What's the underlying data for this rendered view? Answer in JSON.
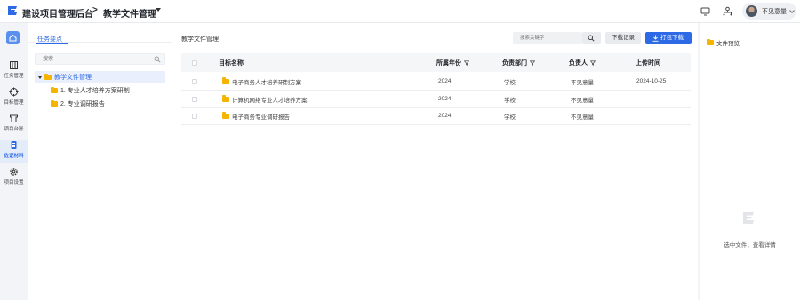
{
  "header": {
    "app_title": "建设项目管理后台",
    "separator": ">",
    "page_title": "教学文件管理",
    "user_name": "不见意量"
  },
  "nav": {
    "items": [
      {
        "label": "任务管理",
        "icon": "tasks-icon"
      },
      {
        "label": "目标管理",
        "icon": "target-icon"
      },
      {
        "label": "项目台账",
        "icon": "ledger-icon"
      },
      {
        "label": "佐证材料",
        "icon": "evidence-icon",
        "active": true
      },
      {
        "label": "项目设置",
        "icon": "settings-icon"
      }
    ]
  },
  "tree": {
    "tab_label": "任务要点",
    "search_placeholder": "搜索",
    "nodes": [
      {
        "label": "教学文件管理",
        "selected": true
      },
      {
        "label": "1. 专业人才培养方案研制"
      },
      {
        "label": "2. 专业调研报告"
      }
    ]
  },
  "main": {
    "title": "教学文件管理",
    "search_placeholder": "搜索关键字",
    "download_log_label": "下载记录",
    "pack_download_label": "打包下载",
    "columns": [
      "目标名称",
      "所属年份",
      "负责部门",
      "负责人",
      "上传时间"
    ],
    "rows": [
      {
        "name": "电子商务人才培养研制方案",
        "year": "2024",
        "dept": "学校",
        "owner": "不见意量",
        "time": "2024-10-25"
      },
      {
        "name": "计算机网络专业人才培养方案",
        "year": "2024",
        "dept": "学校",
        "owner": "不见意量",
        "time": ""
      },
      {
        "name": "电子商务专业调研报告",
        "year": "2024",
        "dept": "学校",
        "owner": "不见意量",
        "time": ""
      }
    ]
  },
  "preview": {
    "title": "文件预览",
    "hint": "选中文件，查看详情"
  },
  "colors": {
    "accent": "#2e6ae5",
    "folder": "#f5b400",
    "nav_active_bg": "#e4ebf9"
  }
}
